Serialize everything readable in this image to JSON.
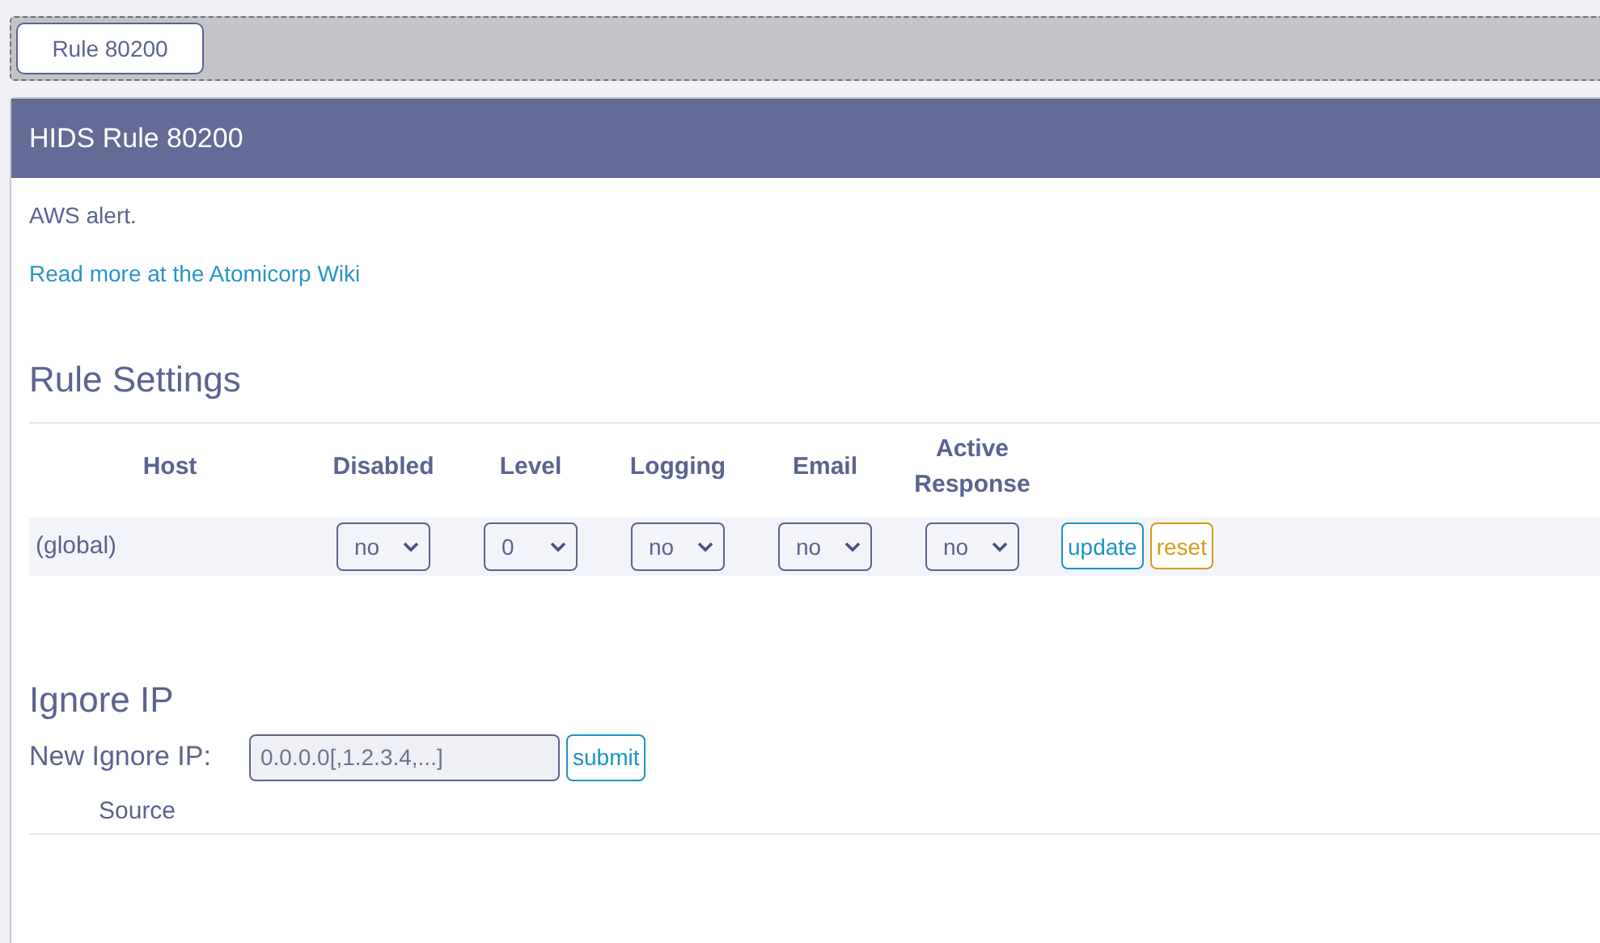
{
  "tabs": [
    {
      "label": "Rule 80200",
      "selected": true
    }
  ],
  "panel": {
    "title": "HIDS Rule 80200",
    "description": "AWS alert.",
    "link": "Read more at the Atomicorp Wiki"
  },
  "rule_settings": {
    "heading": "Rule Settings",
    "columns": [
      "Host",
      "Disabled",
      "Level",
      "Logging",
      "Email",
      "Active Response"
    ],
    "rows": [
      {
        "host": "(global)",
        "values": [
          "no",
          "0",
          "no",
          "no",
          "no"
        ],
        "buttons": [
          {
            "label": "update",
            "kind": "primary"
          },
          {
            "label": "reset",
            "kind": "warning"
          }
        ]
      }
    ]
  },
  "ignore_ip": {
    "heading": "Ignore IP",
    "label": "New Ignore IP:",
    "placeholder": "0.0.0.0[,1.2.3.4,...]",
    "button": "submit",
    "columns": [
      "Source"
    ]
  }
}
